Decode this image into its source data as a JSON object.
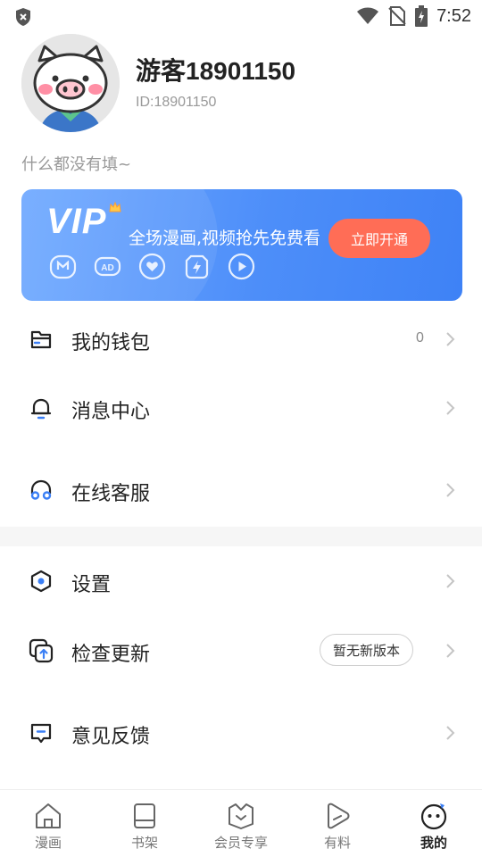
{
  "status_bar": {
    "time": "7:52",
    "icons": [
      "shield-icon",
      "wifi-icon",
      "no-sim-icon",
      "battery-charging-icon"
    ]
  },
  "profile": {
    "name": "游客18901150",
    "id_text": "ID:18901150",
    "avatar": "pig-avatar"
  },
  "bio": "什么都没有填~",
  "vip": {
    "logo": "VIP",
    "slogan": "全场漫画,视频抢先免费看",
    "button": "立即开通",
    "perks": [
      "manga-perk-icon",
      "no-ads-perk-icon",
      "heart-perk-icon",
      "speed-perk-icon",
      "video-perk-icon"
    ]
  },
  "menu": {
    "wallet": {
      "label": "我的钱包",
      "value": "0",
      "icon": "wallet-icon"
    },
    "messages": {
      "label": "消息中心",
      "icon": "bell-icon"
    },
    "support": {
      "label": "在线客服",
      "icon": "headset-icon"
    },
    "settings": {
      "label": "设置",
      "icon": "settings-hex-icon"
    },
    "update": {
      "label": "检查更新",
      "badge": "暂无新版本",
      "icon": "update-icon"
    },
    "feedback": {
      "label": "意见反馈",
      "icon": "feedback-icon"
    }
  },
  "tabs": [
    {
      "label": "漫画",
      "icon": "home-icon",
      "active": false
    },
    {
      "label": "书架",
      "icon": "bookshelf-icon",
      "active": false
    },
    {
      "label": "会员专享",
      "icon": "vip-crown-icon",
      "active": false
    },
    {
      "label": "有料",
      "icon": "play-icon",
      "active": false
    },
    {
      "label": "我的",
      "icon": "profile-face-icon",
      "active": true
    }
  ],
  "colors": {
    "accent_blue": "#4d8ef9",
    "vip_button": "#ff6d56",
    "icon_blue_accent": "#3b7ff5"
  }
}
